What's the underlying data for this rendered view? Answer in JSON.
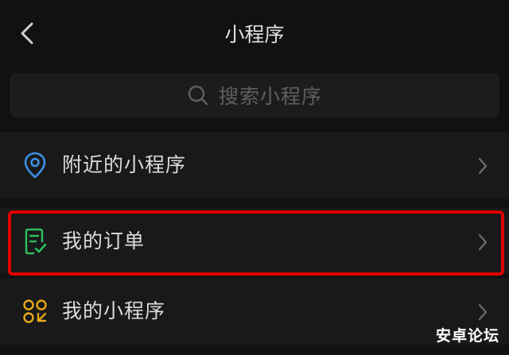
{
  "header": {
    "title": "小程序",
    "back_icon": "chevron-left-icon"
  },
  "search": {
    "placeholder": "搜索小程序",
    "icon": "search-icon"
  },
  "list": {
    "items": [
      {
        "label": "附近的小程序",
        "icon": "location-pin-icon",
        "icon_color": "#3d8fe6"
      },
      {
        "label": "我的订单",
        "icon": "order-check-icon",
        "icon_color": "#2fbf5f",
        "highlighted": true
      },
      {
        "label": "我的小程序",
        "icon": "mini-program-icon",
        "icon_color": "#e6a817"
      }
    ]
  },
  "colors": {
    "background": "#111111",
    "row_background": "#191919",
    "highlight_border": "#e00000"
  },
  "watermark": {
    "text": "安卓论坛"
  }
}
